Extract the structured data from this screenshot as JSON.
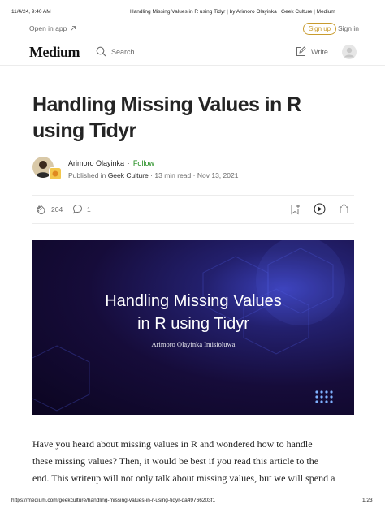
{
  "print_header": {
    "datetime": "11/4/24, 9:40 AM",
    "page_title": "Handling Missing Values in R using Tidyr | by Arimoro Olayinka | Geek Culture | Medium"
  },
  "topbar": {
    "open_in_app": "Open in app",
    "sign_up": "Sign up",
    "sign_in": "Sign in"
  },
  "nav": {
    "logo": "Medium",
    "search": "Search",
    "write": "Write"
  },
  "article": {
    "title": "Handling Missing Values in R using Tidyr",
    "author": "Arimoro Olayinka",
    "follow": "Follow",
    "published_in_prefix": "Published in",
    "publication": "Geek Culture",
    "read_time": "13 min read",
    "date": "Nov 13, 2021",
    "claps": "204",
    "responses": "1"
  },
  "hero": {
    "title_line1": "Handling Missing Values",
    "title_line2": "in R using Tidyr",
    "subtitle": "Arimoro Olayinka Imisioluwa"
  },
  "body": {
    "line1": "Have you heard about missing values in R and wondered how to handle",
    "line2": "these missing values? Then, it would be best if you read this article to the",
    "line3": "end. This writeup will not only talk about missing values, but we will spend a"
  },
  "print_footer": {
    "url": "https://medium.com/geekculture/handling-missing-values-in-r-using-tidyr-da49766203f1",
    "page": "1/23"
  }
}
